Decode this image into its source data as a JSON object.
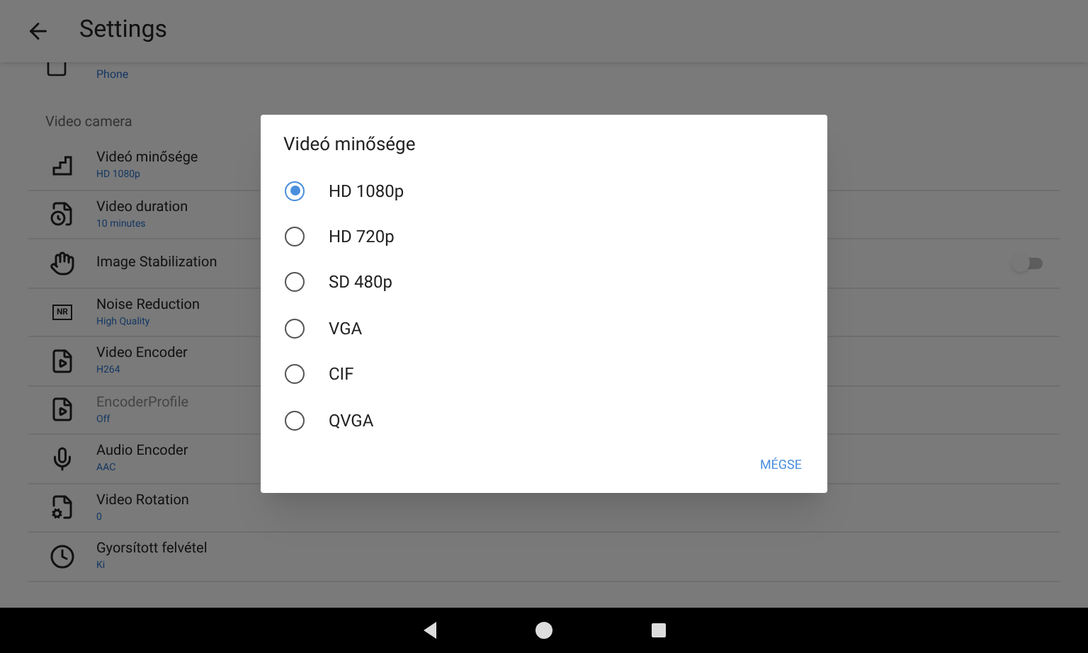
{
  "app_bar": {
    "title": "Settings"
  },
  "top_item": {
    "subtitle": "Phone"
  },
  "section": {
    "title": "Video camera"
  },
  "items": [
    {
      "kind": "value",
      "title": "Videó minősége",
      "subtitle": "HD 1080p",
      "disabled": false
    },
    {
      "kind": "value",
      "title": "Video duration",
      "subtitle": "10 minutes",
      "disabled": false
    },
    {
      "kind": "toggle",
      "title": "Image Stabilization",
      "on": false,
      "disabled": false
    },
    {
      "kind": "value",
      "title": "Noise Reduction",
      "subtitle": "High Quality",
      "badge": "NR",
      "disabled": false
    },
    {
      "kind": "value",
      "title": "Video Encoder",
      "subtitle": "H264",
      "disabled": false
    },
    {
      "kind": "value",
      "title": "EncoderProfile",
      "subtitle": "Off",
      "disabled": true
    },
    {
      "kind": "value",
      "title": "Audio Encoder",
      "subtitle": "AAC",
      "disabled": false
    },
    {
      "kind": "value",
      "title": "Video Rotation",
      "subtitle": "0",
      "disabled": false
    },
    {
      "kind": "value",
      "title": "Gyorsított felvétel",
      "subtitle": "Ki",
      "disabled": false
    }
  ],
  "dialog": {
    "title": "Videó minősége",
    "options": [
      {
        "label": "HD 1080p",
        "selected": true
      },
      {
        "label": "HD 720p",
        "selected": false
      },
      {
        "label": "SD 480p",
        "selected": false
      },
      {
        "label": "VGA",
        "selected": false
      },
      {
        "label": "CIF",
        "selected": false
      },
      {
        "label": "QVGA",
        "selected": false
      }
    ],
    "cancel": "MÉGSE"
  }
}
